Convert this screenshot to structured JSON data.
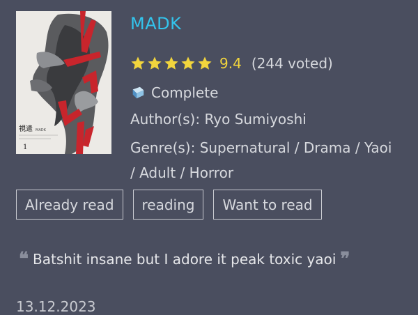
{
  "manga": {
    "title": "MADK",
    "rating": {
      "score": "9.4",
      "votes": "(244 voted)",
      "stars": 5
    },
    "status": "Complete",
    "author": "Author(s): Ryo Sumiyoshi",
    "genre": "Genre(s): Supernatural / Drama / Yaoi / Adult / Horror",
    "cover": {
      "title_jp": "視遣",
      "title_en": "MADK",
      "volume": "1"
    }
  },
  "shelf": {
    "already_read": "Already read",
    "reading": "reading",
    "want_to_read": "Want to read"
  },
  "review": {
    "text": "Batshit insane but I adore it peak toxic yaoi",
    "date": "13.12.2023"
  },
  "colors": {
    "background": "#4a4e5f",
    "title": "#33c4ec",
    "star": "#f2d53d",
    "cover_red": "#c8252c"
  },
  "icons": [
    "star-icon",
    "book-icon",
    "open-quote-icon",
    "close-quote-icon"
  ]
}
